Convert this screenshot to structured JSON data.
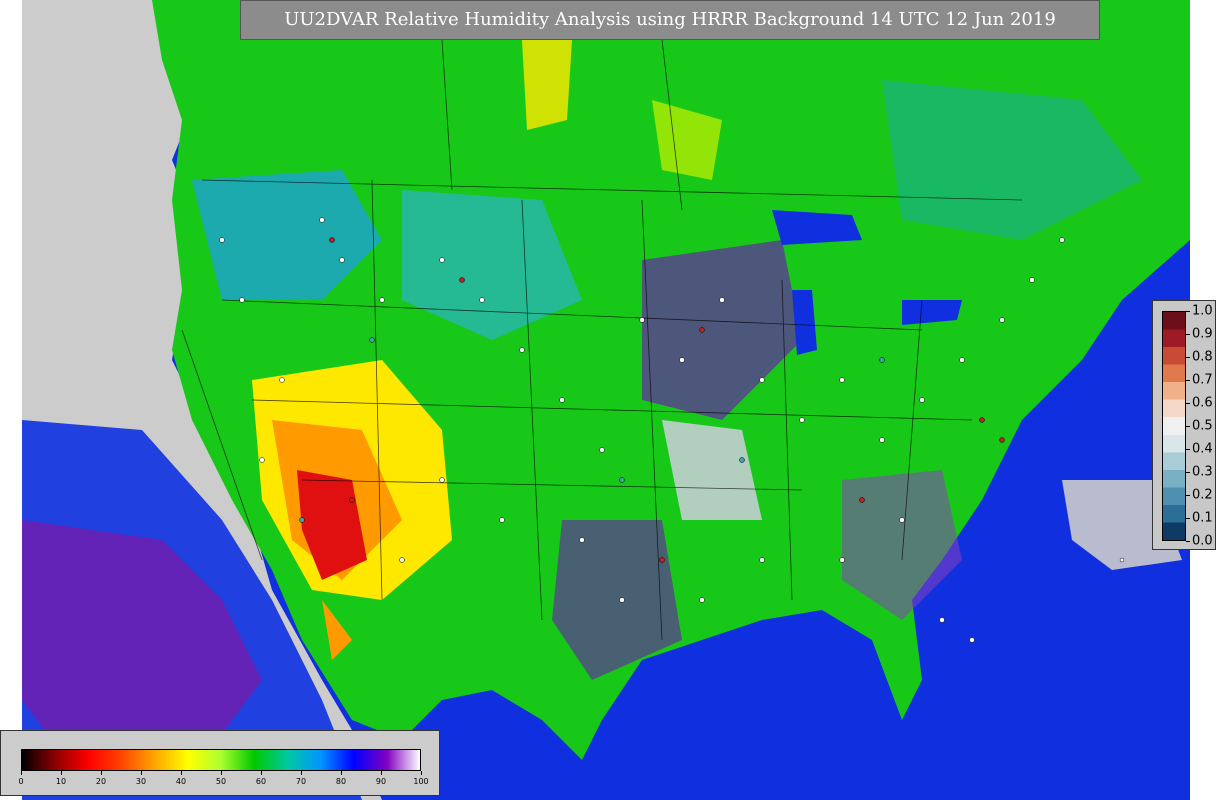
{
  "title": "UU2DVAR Relative Humidity Analysis using HRRR Background 14 UTC 12 Jun 2019",
  "humidity_legend": {
    "ticks": [
      "0",
      "10",
      "20",
      "30",
      "40",
      "50",
      "60",
      "70",
      "80",
      "90",
      "100"
    ],
    "stops": [
      "#000000",
      "#8b0000",
      "#ff0000",
      "#ff4500",
      "#ffa500",
      "#ffff00",
      "#adff2f",
      "#00c800",
      "#00c8a0",
      "#0096ff",
      "#0000ff",
      "#8000c0",
      "#ffffff"
    ]
  },
  "increment_legend": {
    "ticks": [
      "0.0",
      "0.1",
      "0.2",
      "0.3",
      "0.4",
      "0.5",
      "0.6",
      "0.7",
      "0.8",
      "0.9",
      "1.0"
    ],
    "colors": [
      "#0d3b66",
      "#2a6f97",
      "#4f8fb0",
      "#7ab0c4",
      "#a9cdd6",
      "#d9e6ea",
      "#f0f0f0",
      "#f6d8c8",
      "#f0b08a",
      "#e07a4d",
      "#c94a35",
      "#9e1a24",
      "#6b0f1a"
    ]
  },
  "colors": {
    "background_gray": "#cccccc",
    "ocean_blue": "#1030e0",
    "land_green": "#18c818",
    "desert_red": "#e01010"
  }
}
